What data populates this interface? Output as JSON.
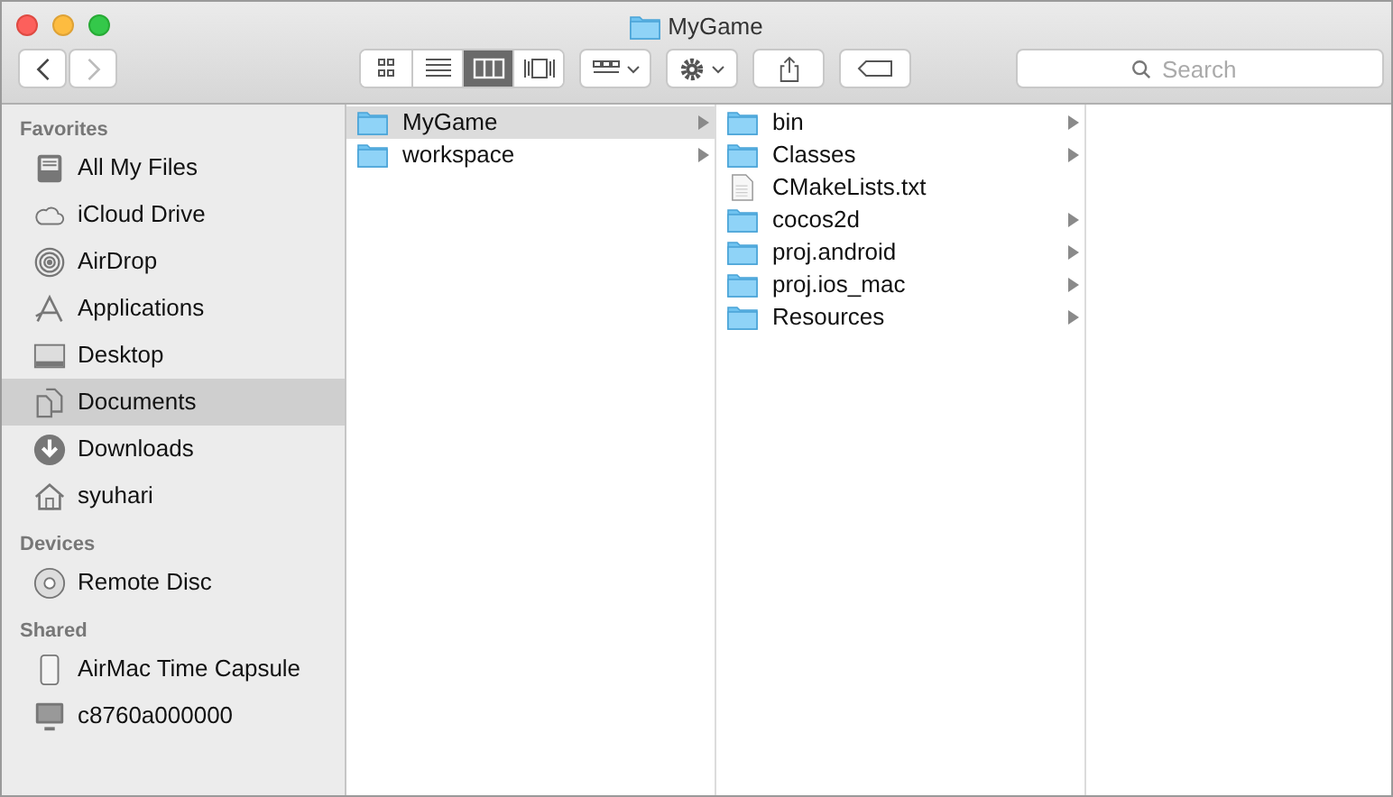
{
  "window": {
    "title": "MyGame"
  },
  "toolbar": {
    "view_modes": [
      {
        "kind": "icons",
        "selected": false
      },
      {
        "kind": "list",
        "selected": false
      },
      {
        "kind": "columns",
        "selected": true
      },
      {
        "kind": "coverflow",
        "selected": false
      }
    ],
    "search": {
      "placeholder": "Search"
    }
  },
  "sidebar": {
    "sections": [
      {
        "title": "Favorites",
        "items": [
          {
            "label": "All My Files",
            "kind": "files",
            "selected": false
          },
          {
            "label": "iCloud Drive",
            "kind": "cloud",
            "selected": false
          },
          {
            "label": "AirDrop",
            "kind": "airdrop",
            "selected": false
          },
          {
            "label": "Applications",
            "kind": "apps",
            "selected": false
          },
          {
            "label": "Desktop",
            "kind": "desktop",
            "selected": false
          },
          {
            "label": "Documents",
            "kind": "documents",
            "selected": true
          },
          {
            "label": "Downloads",
            "kind": "downloads",
            "selected": false
          },
          {
            "label": "syuhari",
            "kind": "home",
            "selected": false
          }
        ]
      },
      {
        "title": "Devices",
        "items": [
          {
            "label": "Remote Disc",
            "kind": "disc",
            "selected": false
          }
        ]
      },
      {
        "title": "Shared",
        "items": [
          {
            "label": "AirMac Time Capsule",
            "kind": "capsule",
            "selected": false
          },
          {
            "label": "c8760a000000",
            "kind": "computer",
            "selected": false
          }
        ]
      }
    ]
  },
  "columns": [
    {
      "items": [
        {
          "name": "MyGame",
          "kind": "folder",
          "selected": true,
          "expandable": true
        },
        {
          "name": "workspace",
          "kind": "folder",
          "selected": false,
          "expandable": true
        }
      ]
    },
    {
      "items": [
        {
          "name": "bin",
          "kind": "folder",
          "selected": false,
          "expandable": true
        },
        {
          "name": "Classes",
          "kind": "folder",
          "selected": false,
          "expandable": true
        },
        {
          "name": "CMakeLists.txt",
          "kind": "file",
          "selected": false,
          "expandable": false
        },
        {
          "name": "cocos2d",
          "kind": "folder",
          "selected": false,
          "expandable": true
        },
        {
          "name": "proj.android",
          "kind": "folder",
          "selected": false,
          "expandable": true
        },
        {
          "name": "proj.ios_mac",
          "kind": "folder",
          "selected": false,
          "expandable": true
        },
        {
          "name": "Resources",
          "kind": "folder",
          "selected": false,
          "expandable": true
        }
      ]
    }
  ]
}
